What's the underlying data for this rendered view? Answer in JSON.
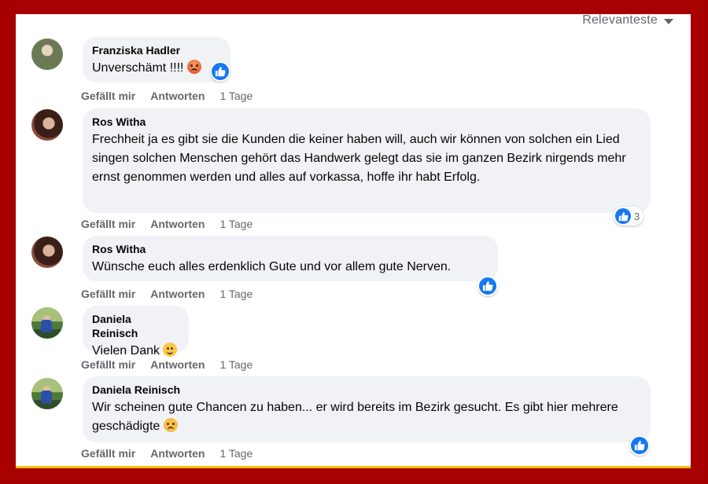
{
  "sort": {
    "label": "Relevanteste"
  },
  "comments": [
    {
      "author": "Franziska Hadler",
      "text": "Unverschämt !!!!",
      "like": "Gefällt mir",
      "reply": "Antworten",
      "time": "1 Tage",
      "emoji": "angry-face-icon",
      "reaction": "like-icon"
    },
    {
      "author": "Ros Witha",
      "text": "Frechheit ja es gibt sie die Kunden die keiner haben will, auch wir können von solchen ein Lied singen solchen Menschen gehört das Handwerk gelegt das sie im ganzen Bezirk nirgends mehr ernst genommen werden und alles auf vorkassa, hoffe ihr habt Erfolg.",
      "like": "Gefällt mir",
      "reply": "Antworten",
      "time": "1 Tage",
      "reaction": "like-icon",
      "reaction_count": "3"
    },
    {
      "author": "Ros Witha",
      "text": "Wünsche euch alles erdenklich Gute und vor allem gute Nerven.",
      "like": "Gefällt mir",
      "reply": "Antworten",
      "time": "1 Tage",
      "reaction": "like-icon"
    },
    {
      "author": "Daniela Reinisch",
      "text": "Vielen Dank",
      "like": "Gefällt mir",
      "reply": "Antworten",
      "time": "1 Tage",
      "emoji": "smiling-face-icon"
    },
    {
      "author": "Daniela Reinisch",
      "text": "Wir scheinen gute Chancen zu haben... er wird bereits im Bezirk gesucht. Es gibt hier mehrere geschädigte",
      "like": "Gefällt mir",
      "reply": "Antworten",
      "time": "1 Tage",
      "emoji": "sad-face-icon",
      "reaction": "like-icon"
    }
  ],
  "colors": {
    "frame": "#a80000",
    "bubble": "#f0f2f5",
    "like_blue": "#1877f2",
    "meta_gray": "#65676b"
  }
}
